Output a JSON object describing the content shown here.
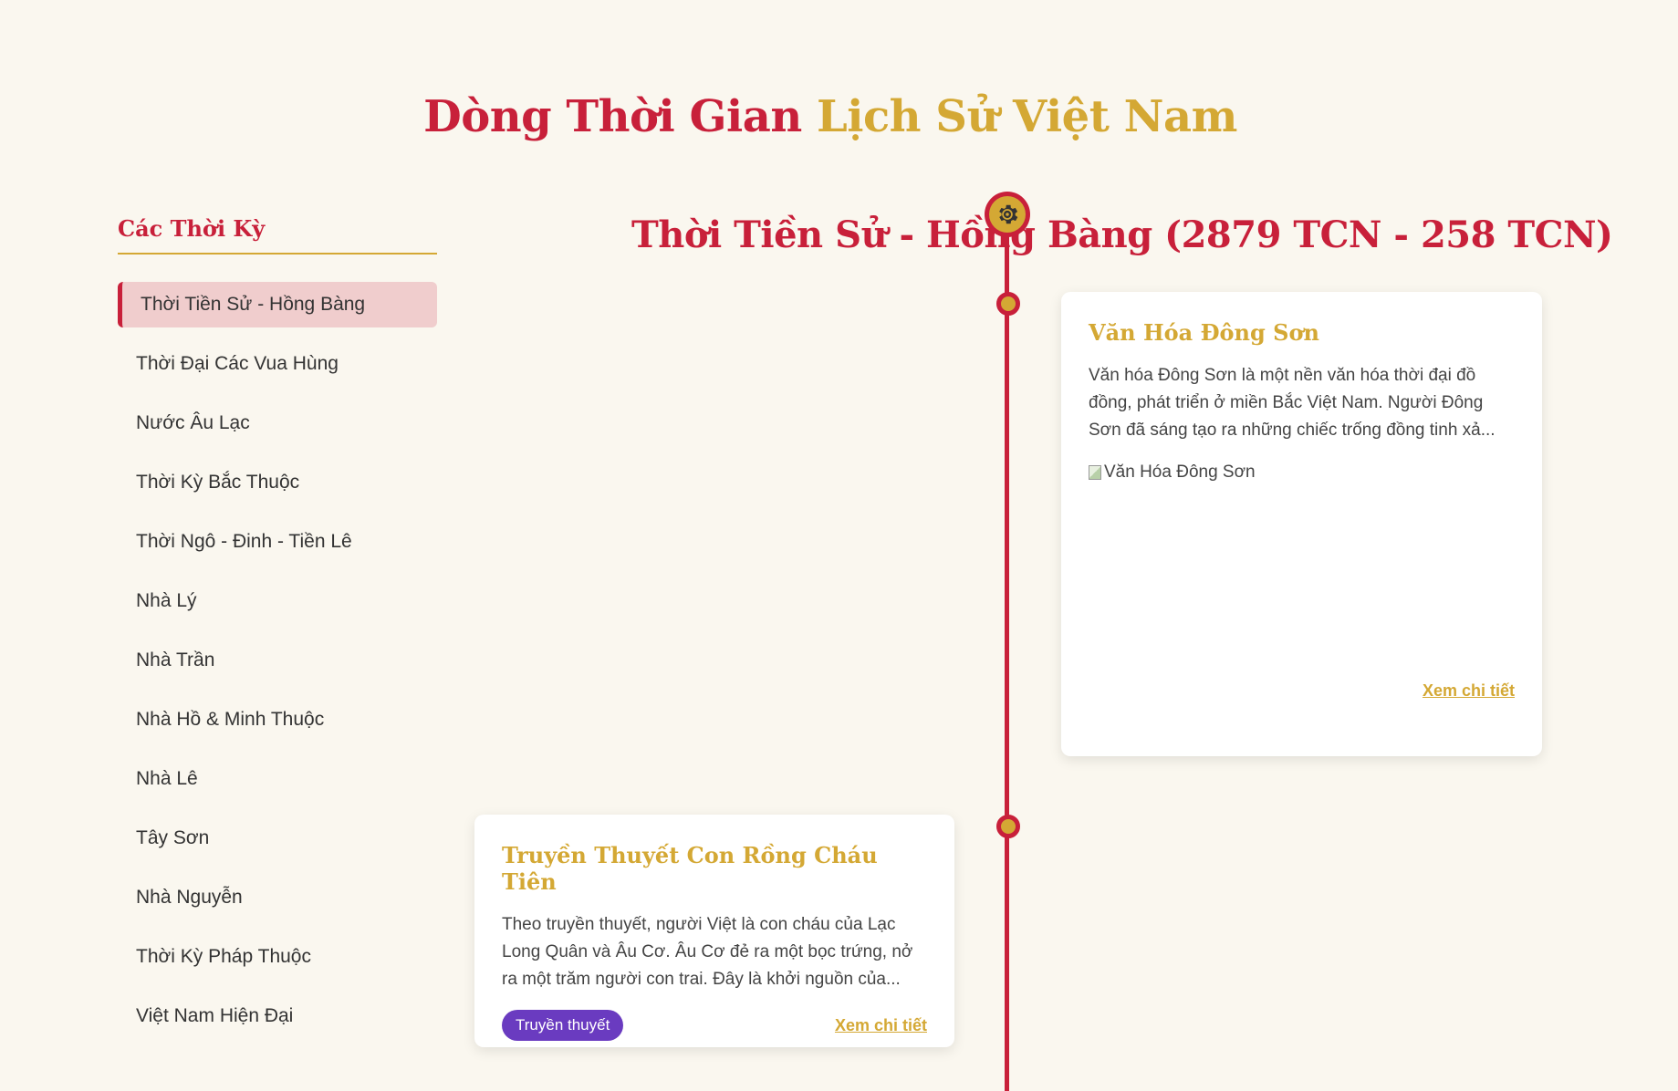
{
  "header": {
    "title_part1": "Dòng Thời Gian",
    "title_part2": "Lịch Sử Việt Nam"
  },
  "sidebar": {
    "heading": "Các Thời Kỳ",
    "items": [
      {
        "label": "Thời Tiền Sử - Hồng Bàng",
        "active": true
      },
      {
        "label": "Thời Đại Các Vua Hùng"
      },
      {
        "label": "Nước Âu Lạc"
      },
      {
        "label": "Thời Kỳ Bắc Thuộc"
      },
      {
        "label": "Thời Ngô - Đinh - Tiền Lê"
      },
      {
        "label": "Nhà Lý"
      },
      {
        "label": "Nhà Trần"
      },
      {
        "label": "Nhà Hồ & Minh Thuộc"
      },
      {
        "label": "Nhà Lê"
      },
      {
        "label": "Tây Sơn"
      },
      {
        "label": "Nhà Nguyễn"
      },
      {
        "label": "Thời Kỳ Pháp Thuộc"
      },
      {
        "label": "Việt Nam Hiện Đại"
      }
    ]
  },
  "timeline": {
    "period_title": "Thời Tiền Sử - Hồng Bàng (2879 TCN - 258 TCN)",
    "badge_icon": "gear-icon",
    "events": [
      {
        "title": "Văn Hóa Đông Sơn",
        "description": "Văn hóa Đông Sơn là một nền văn hóa thời đại đồ đồng, phát triển ở miền Bắc Việt Nam. Người Đông Sơn đã sáng tạo ra những chiếc trống đồng tinh xả...",
        "image_alt": "Văn Hóa Đông Sơn",
        "link": "Xem chi tiết"
      },
      {
        "title": "Truyền Thuyết Con Rồng Cháu Tiên",
        "description": "Theo truyền thuyết, người Việt là con cháu của Lạc Long Quân và Âu Cơ. Âu Cơ đẻ ra một bọc trứng, nở ra một trăm người con trai. Đây là khởi nguồn của...",
        "tag": "Truyền thuyết",
        "link": "Xem chi tiết"
      }
    ]
  },
  "colors": {
    "background": "#faf7ef",
    "primary_red": "#c8203a",
    "accent_gold": "#d4a834",
    "tag_purple": "#6a3bc0"
  }
}
